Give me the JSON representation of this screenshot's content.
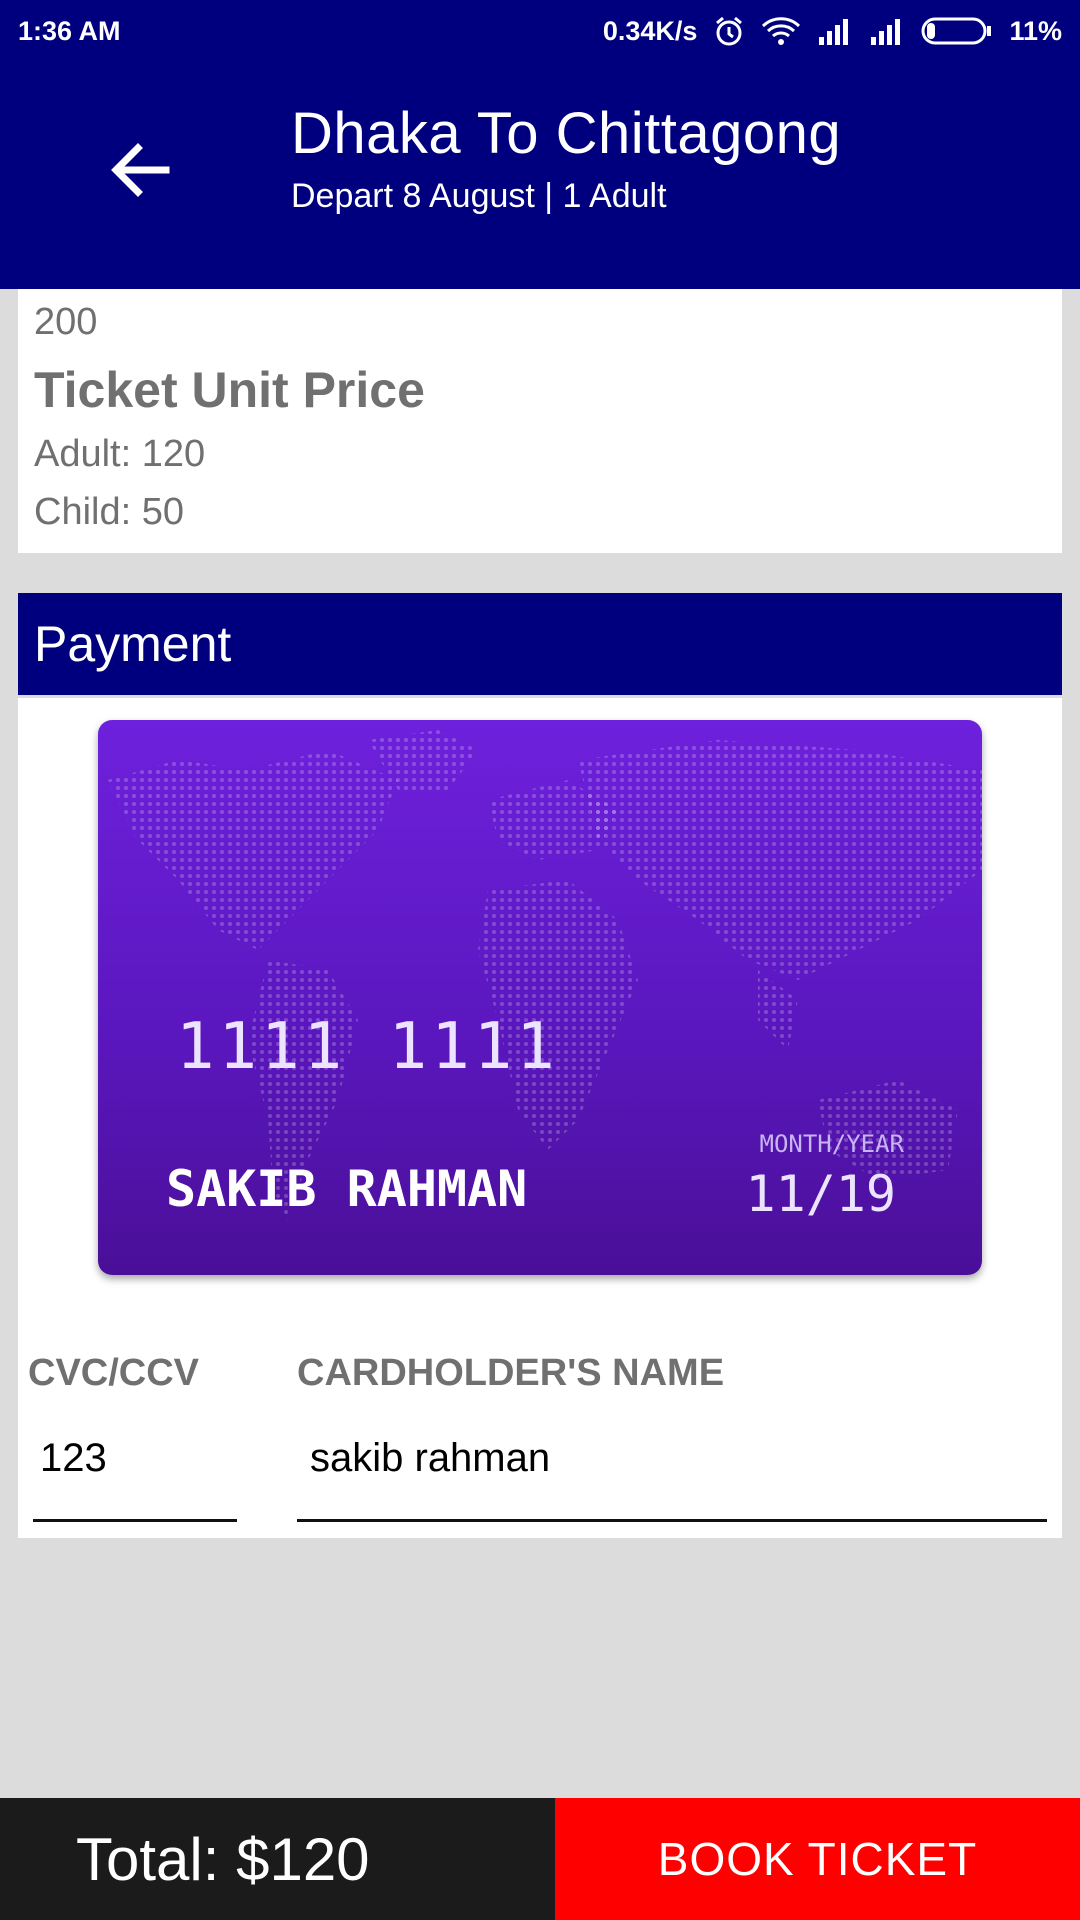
{
  "status_bar": {
    "time": "1:36 AM",
    "network_speed": "0.34K/s",
    "battery": "11%",
    "icons": [
      "alarm-icon",
      "wifi-icon",
      "signal-icon",
      "signal-icon",
      "battery-icon"
    ]
  },
  "app_bar": {
    "title": "Dhaka To Chittagong",
    "subtitle": "Depart 8 August | 1 Adult",
    "back_icon": "arrow-left-icon",
    "background": "#00007f"
  },
  "price_info": {
    "top_value": "200",
    "heading": "Ticket Unit Price",
    "adult": "Adult: 120",
    "child": "Child: 50"
  },
  "payment": {
    "heading": "Payment",
    "card": {
      "number": "1111  1111",
      "holder": "SAKIB RAHMAN",
      "expiry_label": "MONTH/YEAR",
      "expiry": "11/19",
      "color": "#6a1fd6"
    },
    "cvc_label": "CVC/CCV",
    "cvc_value": "123",
    "name_label": "CARDHOLDER'S NAME",
    "name_value": "sakib rahman"
  },
  "footer": {
    "total": "Total: $120",
    "book_label": "BOOK TICKET",
    "book_color": "#ff0000"
  }
}
